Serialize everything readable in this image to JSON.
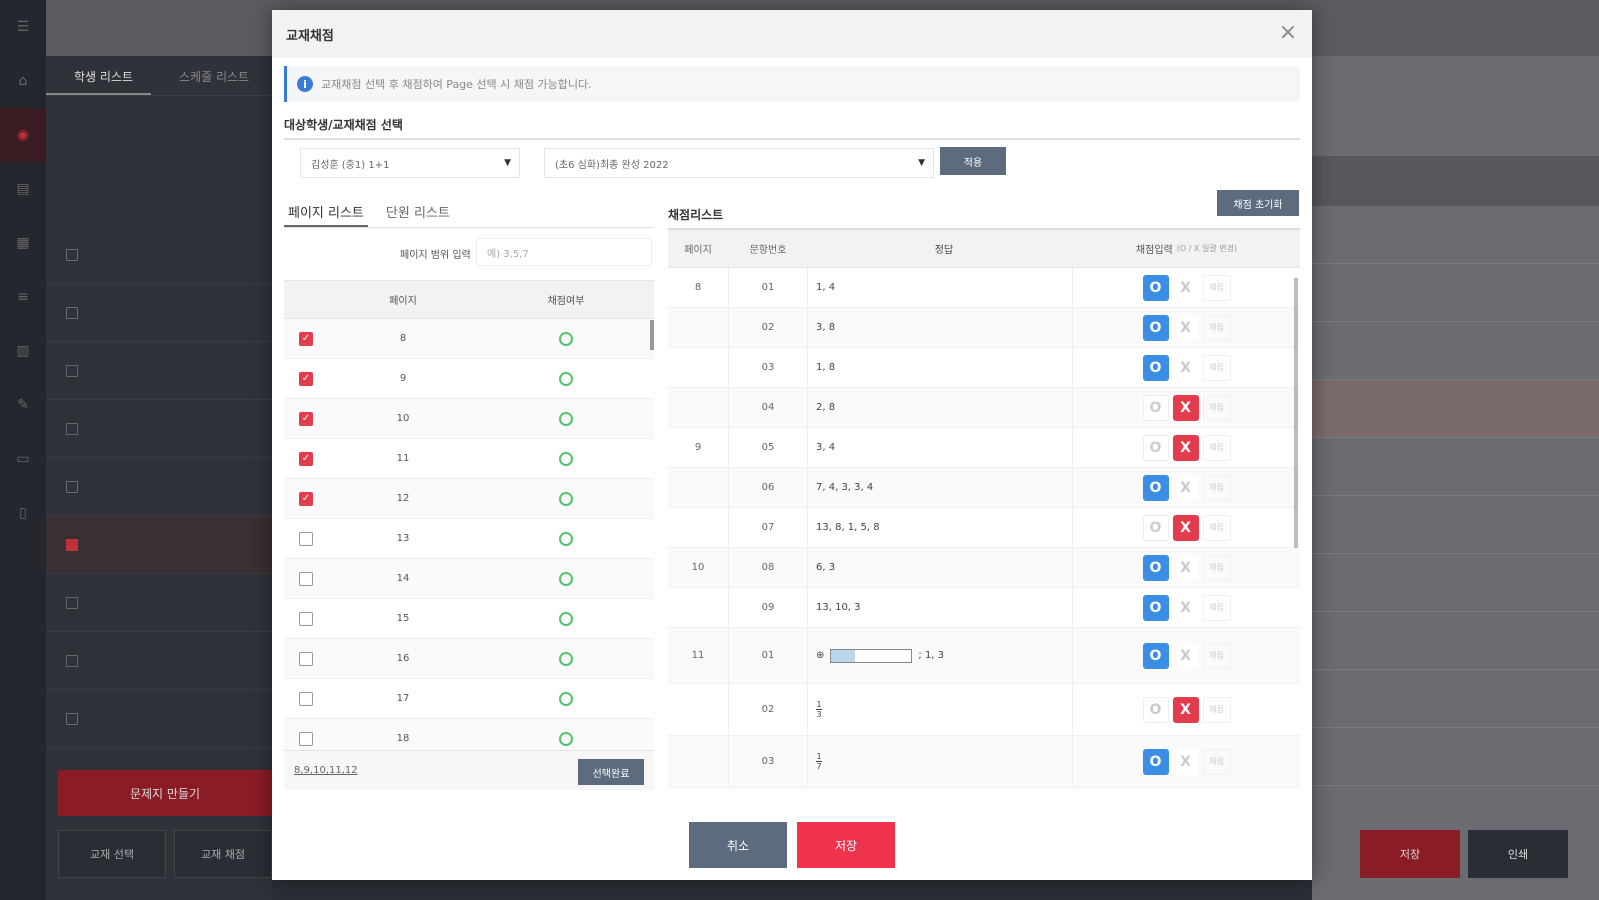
{
  "background": {
    "student_panel": {
      "tabs": [
        "학생 리스트",
        "스케줄 리스트"
      ]
    },
    "left_buttons": [
      "문제지 만들기",
      "교재 선택",
      "교재 채점"
    ],
    "right_buttons": [
      "저장",
      "인쇄"
    ]
  },
  "modal": {
    "title": "교재채점",
    "close": "×",
    "notice": "교재채점 선택 후 채점하여 Page 선택 시 채점 가능합니다.",
    "section_title": "대상학생/교재채점 선택",
    "student_select": "김성훈 (중1) 1+1",
    "book_select": "(초6 심화)최종 완성 2022",
    "apply_label": "적용",
    "left_tabs": [
      "페이지 리스트",
      "단원 리스트"
    ],
    "range_label": "페이지 범위 입력",
    "range_placeholder": "예) 3,5,7",
    "page_table": {
      "headers": [
        "페이지",
        "채점여부"
      ],
      "rows": [
        {
          "page": "8",
          "checked": true
        },
        {
          "page": "9",
          "checked": true
        },
        {
          "page": "10",
          "checked": true
        },
        {
          "page": "11",
          "checked": true
        },
        {
          "page": "12",
          "checked": true
        },
        {
          "page": "13",
          "checked": false
        },
        {
          "page": "14",
          "checked": false
        },
        {
          "page": "15",
          "checked": false
        },
        {
          "page": "16",
          "checked": false
        },
        {
          "page": "17",
          "checked": false
        },
        {
          "page": "18",
          "checked": false
        }
      ]
    },
    "selected_pages": "8,9,10,11,12",
    "select_save_label": "선택완료",
    "grade_title": "채점리스트",
    "reset_label": "채점 초기화",
    "grade_table": {
      "headers": [
        "페이지",
        "문항번호",
        "정답",
        "채점입력"
      ],
      "header_hint": "(O / X 일괄 변경)",
      "rows": [
        {
          "page": "8",
          "no": "01",
          "answer": "1, 4",
          "result": "O"
        },
        {
          "page": "",
          "no": "02",
          "answer": "3, 8",
          "result": "O"
        },
        {
          "page": "",
          "no": "03",
          "answer": "1, 8",
          "result": "O"
        },
        {
          "page": "",
          "no": "04",
          "answer": "2, 8",
          "result": "X"
        },
        {
          "page": "9",
          "no": "05",
          "answer": "3, 4",
          "result": "X"
        },
        {
          "page": "",
          "no": "06",
          "answer": "7, 4, 3, 3, 4",
          "result": "O"
        },
        {
          "page": "",
          "no": "07",
          "answer": "13, 8, 1, 5, 8",
          "result": "X"
        },
        {
          "page": "10",
          "no": "08",
          "answer": "6, 3",
          "result": "O"
        },
        {
          "page": "",
          "no": "09",
          "answer": "13, 10, 3",
          "result": "O"
        },
        {
          "page": "11",
          "no": "01",
          "answer": "; 1, 3",
          "result": "O",
          "figure": true
        },
        {
          "page": "",
          "no": "02",
          "answer": "",
          "result": "X",
          "fraction": [
            "1",
            "3"
          ]
        },
        {
          "page": "",
          "no": "03",
          "answer": "",
          "result": "O",
          "fraction": [
            "1",
            "7"
          ]
        }
      ],
      "o_label": "O",
      "x_label": "X",
      "mark_label": "채점"
    },
    "cancel_label": "취소",
    "save_label": "저장"
  }
}
